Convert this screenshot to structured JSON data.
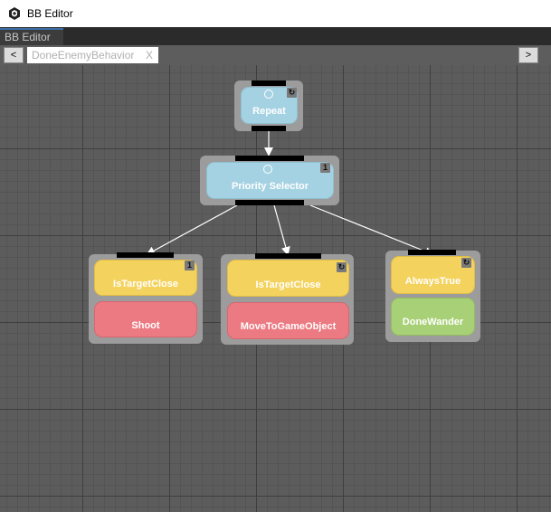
{
  "window": {
    "title": "BB Editor"
  },
  "panel_tab": {
    "label": "BB Editor"
  },
  "toolbar": {
    "prev_label": "<",
    "next_label": ">"
  },
  "document_tab": {
    "label": "DoneEnemyBehavior",
    "close_label": "X"
  },
  "graph": {
    "repeat": {
      "label": "Repeat",
      "badge": "↻"
    },
    "priority_selector": {
      "label": "Priority Selector",
      "badge": "1"
    },
    "node_left": {
      "condition": "IsTargetClose",
      "action": "Shoot",
      "badge": "1"
    },
    "node_middle": {
      "condition": "IsTargetClose",
      "action": "MoveToGameObject",
      "badge": "↻"
    },
    "node_right": {
      "condition": "AlwaysTrue",
      "action": "DoneWander",
      "badge": "↻"
    }
  },
  "colors": {
    "selector_block": "#a5d2e2",
    "condition_block": "#f4d25e",
    "action_block": "#ec7a82",
    "action_block_alt": "#a8d076",
    "node_frame": "#9c9c9c",
    "canvas": "#5c5c5c"
  }
}
